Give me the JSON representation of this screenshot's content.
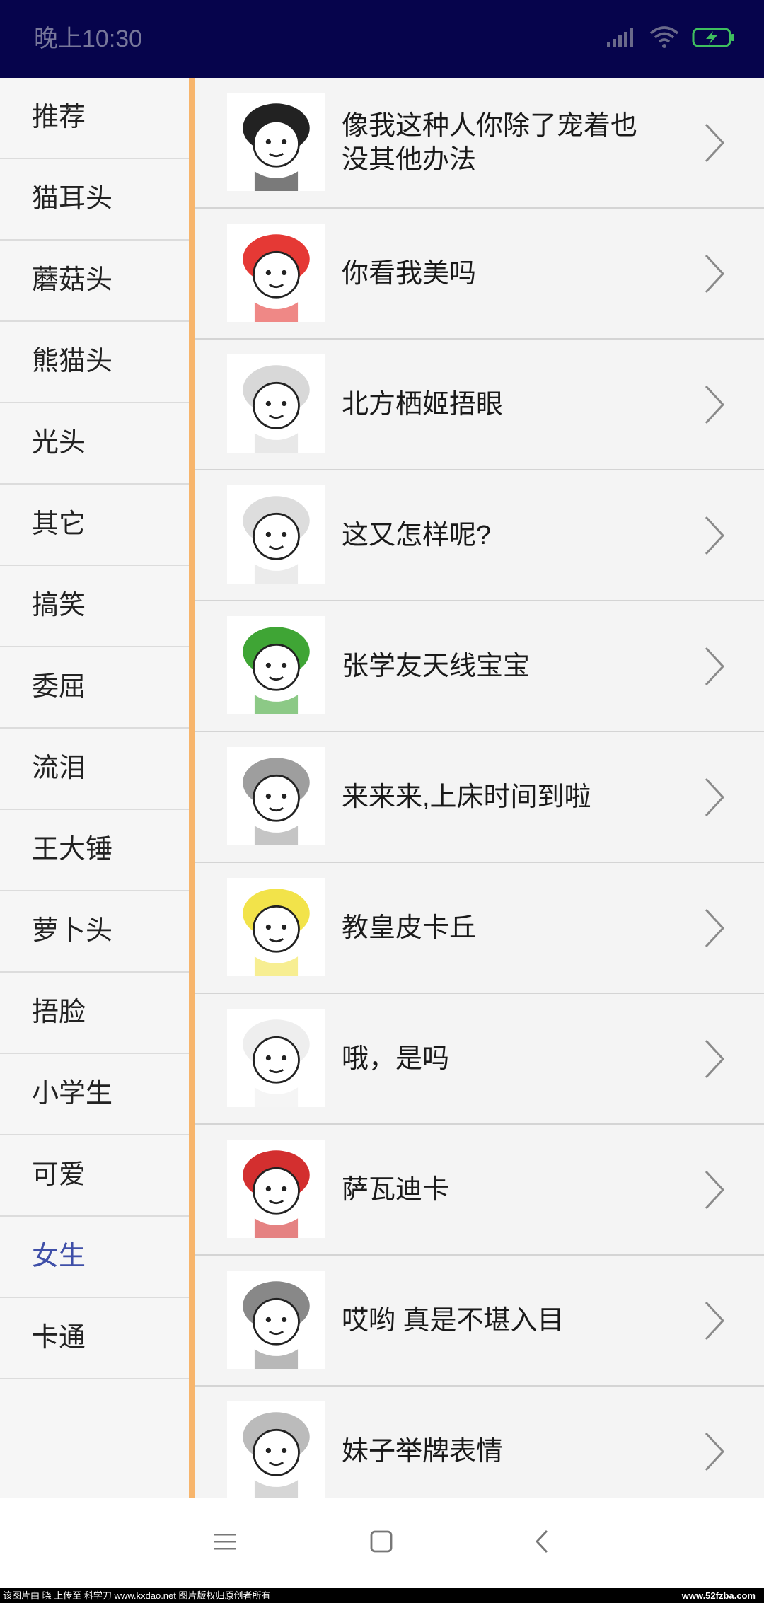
{
  "status_bar": {
    "time": "晚上10:30",
    "background": "#06044c",
    "icons": [
      "signal-icon",
      "wifi-icon",
      "battery-charging-icon"
    ]
  },
  "sidebar": {
    "selected_color": "#3f4fa8",
    "items": [
      {
        "label": "推荐"
      },
      {
        "label": "猫耳头"
      },
      {
        "label": "蘑菇头"
      },
      {
        "label": "熊猫头"
      },
      {
        "label": "光头"
      },
      {
        "label": "其它"
      },
      {
        "label": "搞笑"
      },
      {
        "label": "委屈"
      },
      {
        "label": "流泪"
      },
      {
        "label": "王大锤"
      },
      {
        "label": "萝卜头"
      },
      {
        "label": "捂脸"
      },
      {
        "label": "小学生"
      },
      {
        "label": "可爱"
      },
      {
        "label": "女生",
        "selected": true
      },
      {
        "label": "卡通"
      }
    ]
  },
  "accent_bar_color": "#f7b56c",
  "list": {
    "items": [
      {
        "title": "像我这种人你除了宠着也没其他办法",
        "thumb_icon": "meme-thumbnail",
        "thumb_accent": "#222222"
      },
      {
        "title": "你看我美吗",
        "thumb_icon": "meme-thumbnail",
        "thumb_accent": "#e53935"
      },
      {
        "title": "北方栖姬捂眼",
        "thumb_icon": "meme-thumbnail",
        "thumb_accent": "#d8d8d8"
      },
      {
        "title": "这又怎样呢?",
        "thumb_icon": "meme-thumbnail",
        "thumb_accent": "#dddddd"
      },
      {
        "title": "张学友天线宝宝",
        "thumb_icon": "meme-thumbnail",
        "thumb_accent": "#3fa535"
      },
      {
        "title": "来来来,上床时间到啦",
        "thumb_icon": "meme-thumbnail",
        "thumb_accent": "#9e9e9e"
      },
      {
        "title": "教皇皮卡丘",
        "thumb_icon": "meme-thumbnail",
        "thumb_accent": "#f2e34a"
      },
      {
        "title": "哦，是吗",
        "thumb_icon": "meme-thumbnail",
        "thumb_accent": "#eeeeee"
      },
      {
        "title": "萨瓦迪卡",
        "thumb_icon": "meme-thumbnail",
        "thumb_accent": "#d32f2f"
      },
      {
        "title": "哎哟 真是不堪入目",
        "thumb_icon": "meme-thumbnail",
        "thumb_accent": "#888888"
      },
      {
        "title": "妹子举牌表情",
        "thumb_icon": "meme-thumbnail",
        "thumb_accent": "#bbbbbb"
      }
    ]
  },
  "nav_bar": {
    "buttons": [
      {
        "icon": "menu-icon"
      },
      {
        "icon": "home-icon"
      },
      {
        "icon": "back-icon"
      }
    ]
  },
  "watermark": {
    "left": "该图片由 晓 上传至 科学刀 www.kxdao.net 图片版权归原创者所有",
    "right": "www.52fzba.com"
  }
}
